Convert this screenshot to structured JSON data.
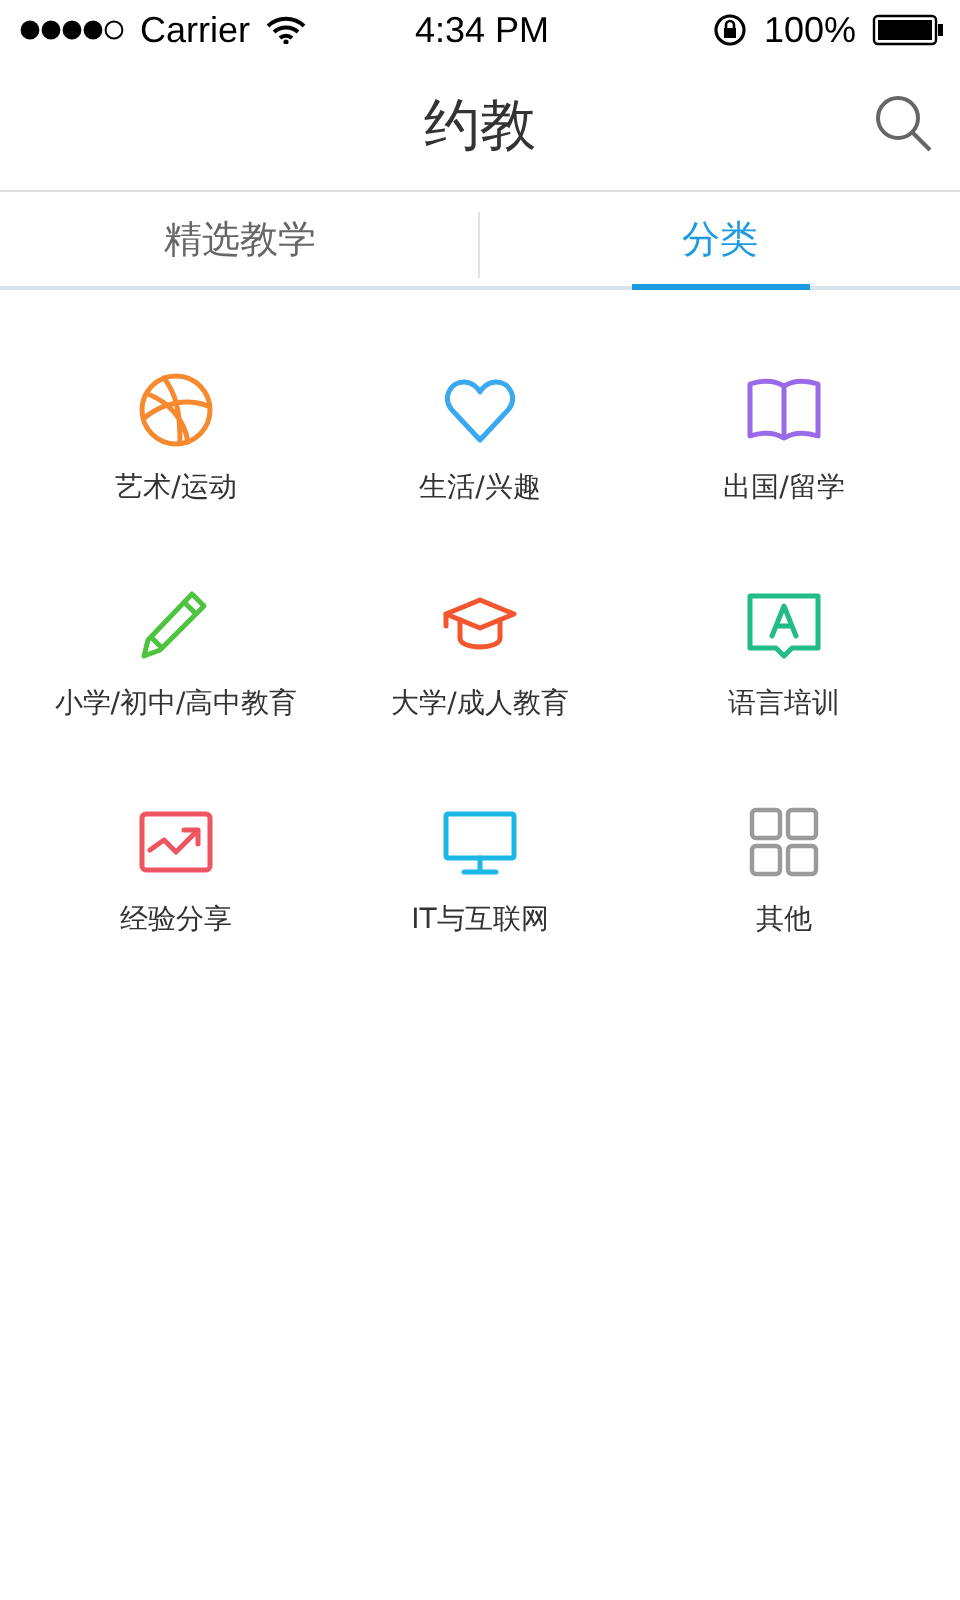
{
  "status_bar": {
    "carrier": "Carrier",
    "time": "4:34 PM",
    "battery": "100%"
  },
  "header": {
    "title": "约教"
  },
  "tabs": [
    {
      "label": "精选教学",
      "selected": false
    },
    {
      "label": "分类",
      "selected": true
    }
  ],
  "categories": [
    {
      "label": "艺术/运动",
      "kind": "ball",
      "color": "#f7892f"
    },
    {
      "label": "生活/兴趣",
      "kind": "heart",
      "color": "#3aa9f0"
    },
    {
      "label": "出国/留学",
      "kind": "book",
      "color": "#9a6be8"
    },
    {
      "label": "小学/初中/高中教育",
      "kind": "pencil",
      "color": "#4cc43f"
    },
    {
      "label": "大学/成人教育",
      "kind": "cap",
      "color": "#f4572d"
    },
    {
      "label": "语言培训",
      "kind": "speech",
      "color": "#22bb8a"
    },
    {
      "label": "经验分享",
      "kind": "chart",
      "color": "#ef5560"
    },
    {
      "label": "IT与互联网",
      "kind": "monitor",
      "color": "#19b8e6"
    },
    {
      "label": "其他",
      "kind": "grid",
      "color": "#9a9a9a"
    }
  ]
}
